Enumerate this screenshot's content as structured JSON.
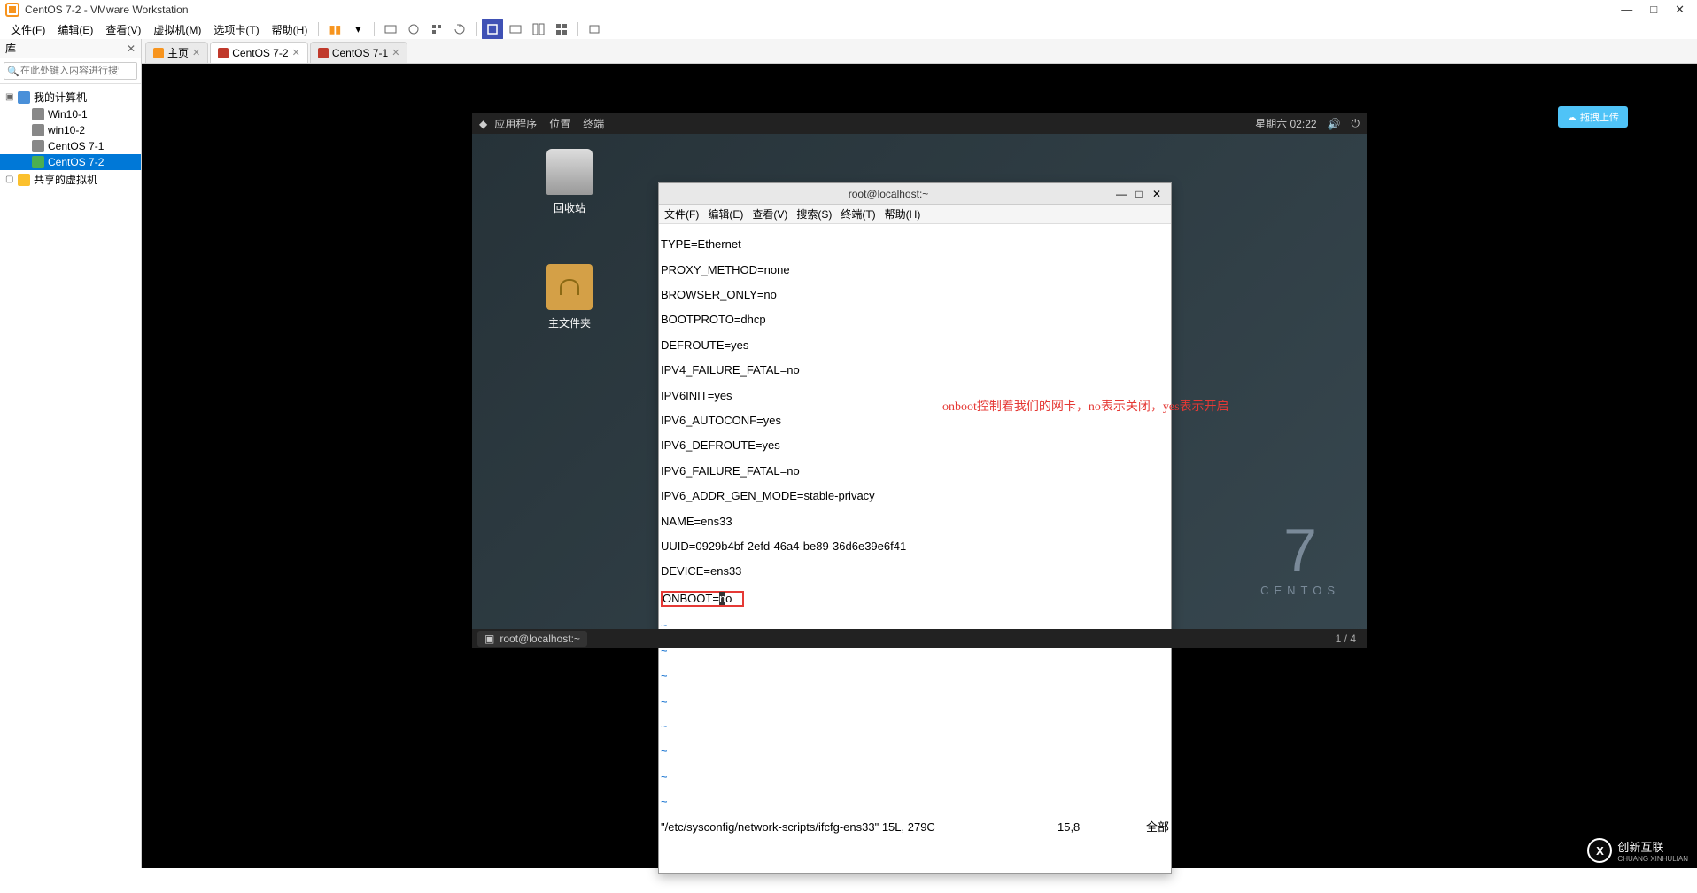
{
  "titlebar": {
    "title": "CentOS 7-2 - VMware Workstation"
  },
  "menubar": {
    "items": [
      "文件(F)",
      "编辑(E)",
      "查看(V)",
      "虚拟机(M)",
      "选项卡(T)",
      "帮助(H)"
    ]
  },
  "library": {
    "title": "库",
    "search_placeholder": "在此处键入内容进行搜索",
    "root": "我的计算机",
    "items": [
      "Win10-1",
      "win10-2",
      "CentOS 7-1",
      "CentOS 7-2"
    ],
    "shared": "共享的虚拟机"
  },
  "tabs": [
    {
      "label": "主页",
      "type": "home",
      "active": false
    },
    {
      "label": "CentOS 7-2",
      "type": "vm",
      "active": true
    },
    {
      "label": "CentOS 7-1",
      "type": "vm",
      "active": false
    }
  ],
  "baidu_button": "拖拽上传",
  "gnome": {
    "bar": {
      "apps": "应用程序",
      "places": "位置",
      "terminal": "终端",
      "clock": "星期六 02:22"
    },
    "desktop": {
      "trash": "回收站",
      "home": "主文件夹"
    },
    "terminal": {
      "title": "root@localhost:~",
      "menu": [
        "文件(F)",
        "编辑(E)",
        "查看(V)",
        "搜索(S)",
        "终端(T)",
        "帮助(H)"
      ],
      "lines": [
        "TYPE=Ethernet",
        "PROXY_METHOD=none",
        "BROWSER_ONLY=no",
        "BOOTPROTO=dhcp",
        "DEFROUTE=yes",
        "IPV4_FAILURE_FATAL=no",
        "IPV6INIT=yes",
        "IPV6_AUTOCONF=yes",
        "IPV6_DEFROUTE=yes",
        "IPV6_FAILURE_FATAL=no",
        "IPV6_ADDR_GEN_MODE=stable-privacy",
        "NAME=ens33",
        "UUID=0929b4bf-2efd-46a4-be89-36d6e39e6f41",
        "DEVICE=ens33"
      ],
      "onboot_prefix": "ONBOOT=",
      "onboot_cursor": "n",
      "onboot_rest": "o",
      "status_file": "\"/etc/sysconfig/network-scripts/ifcfg-ens33\" 15L, 279C",
      "status_pos": "15,8",
      "status_scroll": "全部"
    },
    "annotation": "onboot控制着我们的网卡，no表示关闭，yes表示开启",
    "centos": {
      "seven": "7",
      "name": "CENTOS"
    },
    "taskbar": {
      "app": "root@localhost:~",
      "right": "1 / 4"
    }
  },
  "watermark": {
    "icon": "X",
    "name": "创新互联",
    "sub": "CHUANG XINHULIAN"
  }
}
